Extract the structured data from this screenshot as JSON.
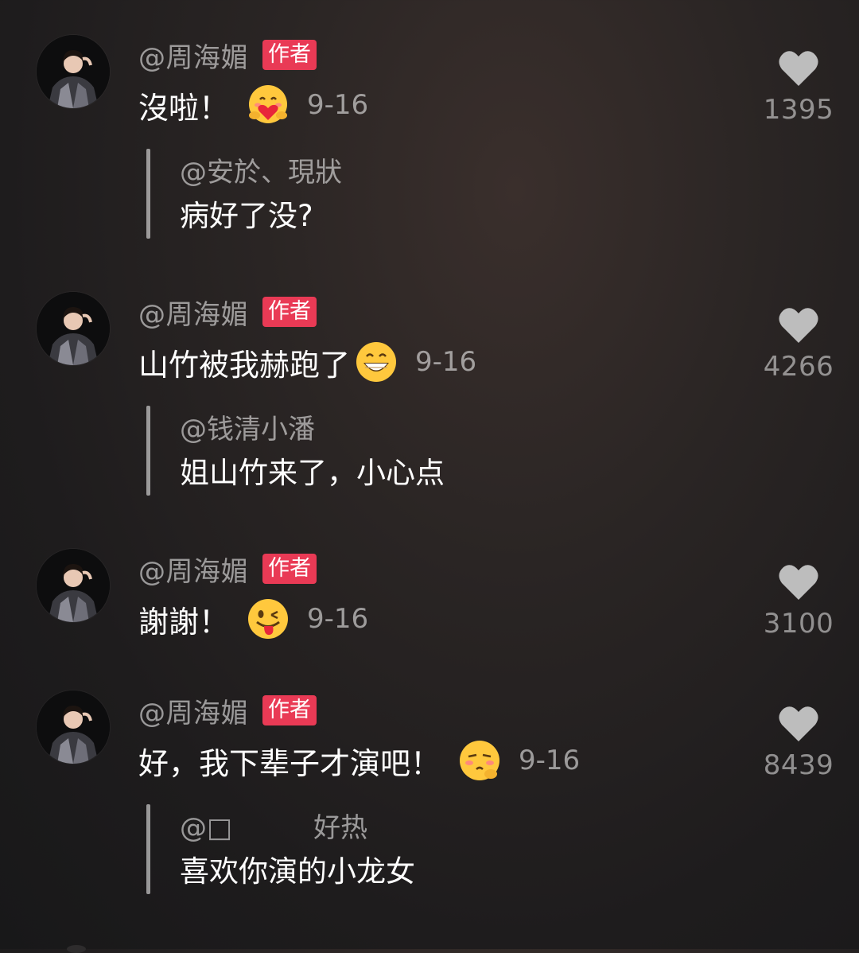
{
  "comments": [
    {
      "username": "@周海媚",
      "badge": "作者",
      "text": "沒啦！",
      "emoji": "hugging-heart-emoji",
      "date": "9-16",
      "likes": "1395",
      "reply": {
        "user": "@安於、現狀",
        "text": "病好了没?"
      }
    },
    {
      "username": "@周海媚",
      "badge": "作者",
      "text": "山竹被我赫跑了",
      "emoji": "grinning-teeth-emoji",
      "date": "9-16",
      "likes": "4266",
      "reply": {
        "user": "@钱清小潘",
        "text": "姐山竹来了，小心点"
      }
    },
    {
      "username": "@周海媚",
      "badge": "作者",
      "text": "謝謝！",
      "emoji": "winking-tongue-emoji",
      "date": "9-16",
      "likes": "3100",
      "reply": null
    },
    {
      "username": "@周海媚",
      "badge": "作者",
      "text": "好，我下辈子才演吧！",
      "emoji": "pensive-blush-emoji",
      "date": "9-16",
      "likes": "8439",
      "reply": {
        "user": "@□　　　好热",
        "text": "喜欢你演的小龙女"
      }
    }
  ],
  "colors": {
    "badge": "#e93a55",
    "emoji_face": "#ffc83d",
    "muted_text": "#9a9898",
    "heart": "#bdbdbd"
  }
}
